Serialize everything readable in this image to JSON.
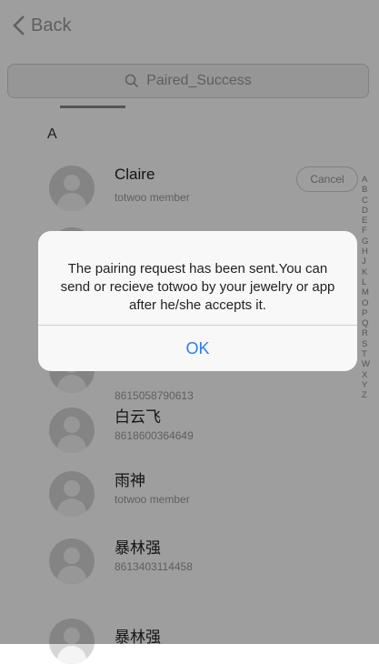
{
  "nav": {
    "back_label": "Back",
    "back_icon": "chevron-left-icon"
  },
  "search": {
    "placeholder": "Paired_Success",
    "icon": "search-icon"
  },
  "section_letter": "A",
  "contacts": [
    {
      "name": "Claire",
      "sub": "totwoo member",
      "action": "Cancel"
    },
    {
      "name": "",
      "sub": ""
    },
    {
      "name": "",
      "sub": "8615058790613"
    },
    {
      "name": "白云飞",
      "sub": "8618600364649"
    },
    {
      "name": "雨神",
      "sub": "totwoo member"
    },
    {
      "name": "暴林强",
      "sub": "8613403114458"
    },
    {
      "name": "暴林强",
      "sub": ""
    }
  ],
  "index_letters": [
    "A",
    "B",
    "C",
    "D",
    "E",
    "F",
    "G",
    "H",
    "J",
    "K",
    "L",
    "M",
    "O",
    "P",
    "Q",
    "R",
    "S",
    "T",
    "W",
    "X",
    "Y",
    "Z"
  ],
  "dialog": {
    "message": "The pairing request has been sent.You can send or recieve totwoo by your jewelry or app after he/she accepts it.",
    "ok_label": "OK"
  },
  "colors": {
    "ok_blue": "#2d7cf6",
    "overlay": "rgba(0,0,0,0.38)"
  }
}
